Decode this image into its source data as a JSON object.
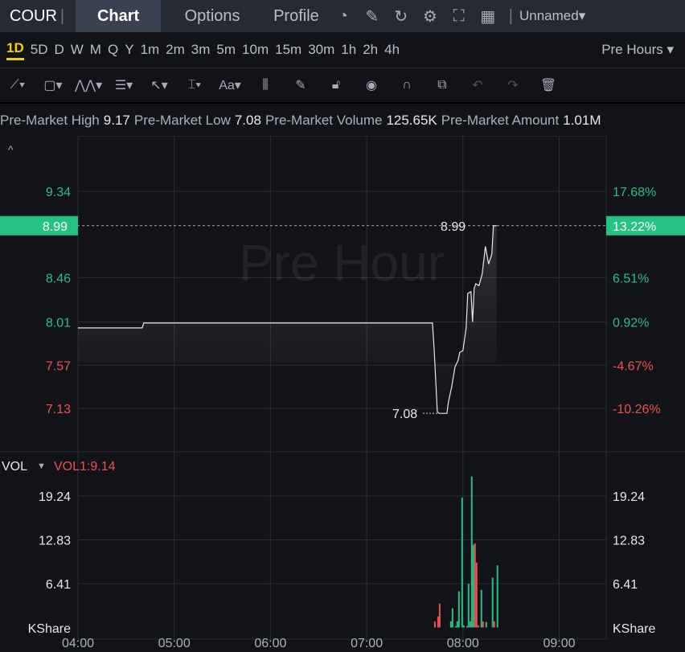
{
  "header": {
    "symbol": "COUR",
    "tabs": [
      "Chart",
      "Options",
      "Profile"
    ],
    "active_tab": "Chart",
    "layout_name": "Unnamed"
  },
  "icons": [
    "speedometer-icon",
    "pencil-note-icon",
    "refresh-icon",
    "gear-icon",
    "fullscreen-icon",
    "grid-layout-icon"
  ],
  "timeframes": [
    "1D",
    "5D",
    "D",
    "W",
    "M",
    "Q",
    "Y",
    "1m",
    "2m",
    "3m",
    "5m",
    "10m",
    "15m",
    "30m",
    "1h",
    "2h",
    "4h"
  ],
  "selected_timeframe": "1D",
  "session_select": "Pre Hours",
  "tools": [
    "trend-line-icon",
    "rectangle-icon",
    "pattern-icon",
    "fib-icon",
    "arrow-icon",
    "measure-icon",
    "text-icon",
    "indicator-icon",
    "brush-icon",
    "lock-icon",
    "eye-icon",
    "magnet-icon",
    "link-icon",
    "undo-icon",
    "redo-icon",
    "trash-icon"
  ],
  "info": [
    {
      "k": "Pre-Market High",
      "v": "9.17"
    },
    {
      "k": "Pre-Market Low",
      "v": "7.08"
    },
    {
      "k": "Pre-Market Volume",
      "v": "125.65K"
    },
    {
      "k": "Pre-Market Amount",
      "v": "1.01M"
    }
  ],
  "watermark": "Pre Hour",
  "colors": {
    "up": "#2ebd85",
    "down": "#f0524f",
    "badge": "#26c281"
  },
  "chart_data": {
    "type": "line",
    "price_ticks": [
      {
        "p": 9.34,
        "pct": "17.68%",
        "c": "up"
      },
      {
        "p": 8.46,
        "pct": "6.51%",
        "c": "up"
      },
      {
        "p": 8.01,
        "pct": "0.92%",
        "c": "up"
      },
      {
        "p": 7.57,
        "pct": "-4.67%",
        "c": "down"
      },
      {
        "p": 7.13,
        "pct": "-10.26%",
        "c": "down"
      }
    ],
    "current": {
      "price": "8.99",
      "pct": "13.22%"
    },
    "high_label": "8.99",
    "low_label": "7.08",
    "x_ticks": [
      "04:00",
      "05:00",
      "06:00",
      "07:00",
      "08:00",
      "09:00"
    ],
    "price": [
      [
        "04:00",
        7.95
      ],
      [
        "04:40",
        7.95
      ],
      [
        "04:41",
        8.0
      ],
      [
        "07:41",
        8.0
      ],
      [
        "07:42",
        7.75
      ],
      [
        "07:44",
        7.1
      ],
      [
        "07:45",
        7.08
      ],
      [
        "07:50",
        7.08
      ],
      [
        "07:51",
        7.2
      ],
      [
        "07:53",
        7.35
      ],
      [
        "07:55",
        7.55
      ],
      [
        "07:57",
        7.62
      ],
      [
        "07:58",
        7.7
      ],
      [
        "08:00",
        7.72
      ],
      [
        "08:02",
        7.95
      ],
      [
        "08:03",
        8.3
      ],
      [
        "08:05",
        8.32
      ],
      [
        "08:06",
        8.01
      ],
      [
        "08:07",
        8.35
      ],
      [
        "08:08",
        8.4
      ],
      [
        "08:10",
        8.38
      ],
      [
        "08:12",
        8.5
      ],
      [
        "08:14",
        8.78
      ],
      [
        "08:16",
        8.6
      ],
      [
        "08:18",
        8.7
      ],
      [
        "08:19",
        8.99
      ],
      [
        "08:21",
        8.99
      ]
    ],
    "volume_label": "VOL",
    "volume_indicator": "VOL1:9.14",
    "vol_ticks": [
      "19.24",
      "12.83",
      "6.41"
    ],
    "vol_unit": "KShare",
    "volume": [
      [
        "07:42",
        0.9,
        "d"
      ],
      [
        "07:44",
        1.6,
        "d"
      ],
      [
        "07:45",
        3.5,
        "d"
      ],
      [
        "07:52",
        0.9,
        "u"
      ],
      [
        "07:53",
        2.8,
        "u"
      ],
      [
        "07:55",
        0.2,
        "u"
      ],
      [
        "07:56",
        0.9,
        "u"
      ],
      [
        "07:57",
        5.3,
        "u"
      ],
      [
        "07:59",
        19.0,
        "u"
      ],
      [
        "08:00",
        0.3,
        "u"
      ],
      [
        "08:02",
        0.2,
        "u"
      ],
      [
        "08:03",
        6.4,
        "u"
      ],
      [
        "08:04",
        0.9,
        "u"
      ],
      [
        "08:05",
        22.1,
        "u"
      ],
      [
        "08:06",
        12.1,
        "u"
      ],
      [
        "08:07",
        12.3,
        "d"
      ],
      [
        "08:08",
        9.5,
        "d"
      ],
      [
        "08:09",
        0.3,
        "d"
      ],
      [
        "08:11",
        5.5,
        "u"
      ],
      [
        "08:12",
        0.9,
        "d"
      ],
      [
        "08:14",
        0.8,
        "u"
      ],
      [
        "08:18",
        7.3,
        "u"
      ],
      [
        "08:19",
        0.9,
        "d"
      ],
      [
        "08:21",
        9.1,
        "u"
      ]
    ]
  }
}
